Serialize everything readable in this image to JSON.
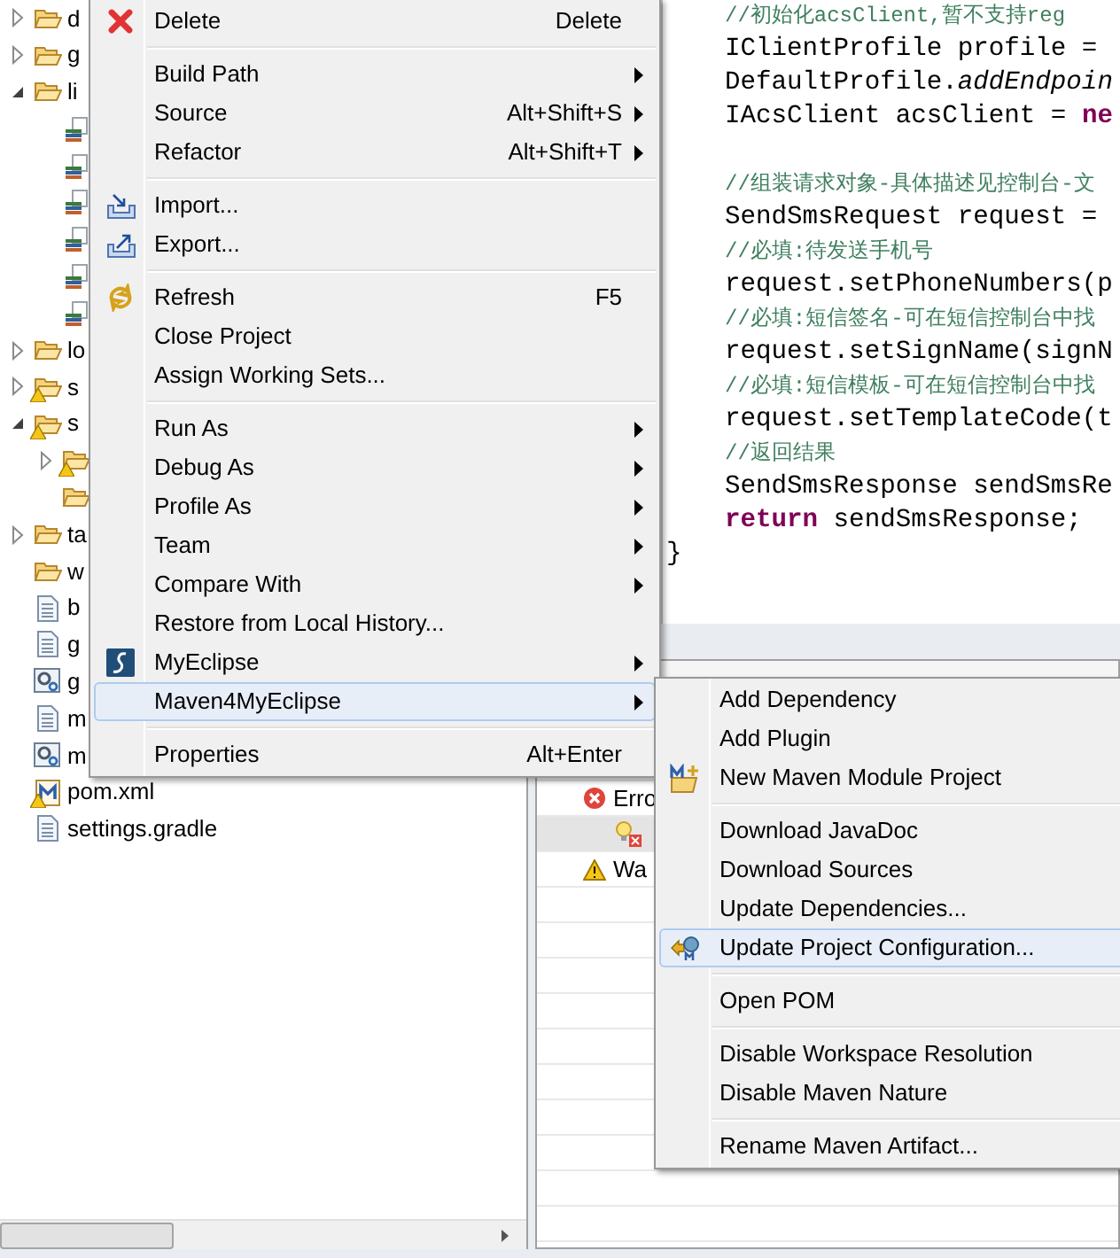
{
  "project_tree": {
    "items": [
      {
        "label": "d",
        "kind": "folder",
        "expanded": false
      },
      {
        "label": "g",
        "kind": "folder",
        "expanded": false
      },
      {
        "label": "li",
        "kind": "folder",
        "expanded": true,
        "children": [
          {
            "kind": "jar"
          },
          {
            "kind": "jar"
          },
          {
            "kind": "jar"
          },
          {
            "kind": "jar"
          },
          {
            "kind": "jar"
          },
          {
            "kind": "jar"
          }
        ]
      },
      {
        "label": "lo",
        "kind": "folder",
        "expanded": false
      },
      {
        "label": "s",
        "kind": "folder",
        "expanded": false,
        "warning": true
      },
      {
        "label": "s",
        "kind": "folder",
        "expanded": true,
        "warning": true,
        "children": [
          {
            "kind": "folder",
            "expanded": false,
            "warning": true
          },
          {
            "kind": "folder"
          }
        ]
      },
      {
        "label": "ta",
        "kind": "folder",
        "expanded": false
      },
      {
        "label": "w",
        "kind": "folder"
      },
      {
        "label": "b",
        "kind": "file"
      },
      {
        "label": "g",
        "kind": "file"
      },
      {
        "label": "g",
        "kind": "config"
      },
      {
        "label": "m",
        "kind": "file"
      },
      {
        "label": "m",
        "kind": "config"
      },
      {
        "label": "pom.xml",
        "kind": "maven",
        "warning": true
      },
      {
        "label": "settings.gradle",
        "kind": "file"
      }
    ]
  },
  "editor": {
    "lines": [
      {
        "kind": "code",
        "indent": true,
        "segments": [
          {
            "text": "//初始化acsClient,暂不支持reg",
            "kind": "comment"
          }
        ]
      },
      {
        "kind": "code",
        "indent": true,
        "segments": [
          {
            "text": "IClientProfile profile = ",
            "kind": "plain"
          }
        ]
      },
      {
        "kind": "code",
        "indent": true,
        "segments": [
          {
            "text": "DefaultProfile.",
            "kind": "plain"
          },
          {
            "text": "addEndpoin",
            "kind": "italic"
          }
        ]
      },
      {
        "kind": "code",
        "indent": true,
        "segments": [
          {
            "text": "IAcsClient acsClient = ",
            "kind": "plain"
          },
          {
            "text": "ne",
            "kind": "keyword"
          }
        ]
      },
      {
        "kind": "blank"
      },
      {
        "kind": "code",
        "indent": true,
        "segments": [
          {
            "text": "//组装请求对象-具体描述见控制台-文",
            "kind": "comment"
          }
        ]
      },
      {
        "kind": "code",
        "indent": true,
        "segments": [
          {
            "text": "SendSmsRequest request = ",
            "kind": "plain"
          }
        ]
      },
      {
        "kind": "code",
        "indent": true,
        "segments": [
          {
            "text": "//必填:待发送手机号",
            "kind": "comment"
          }
        ]
      },
      {
        "kind": "code",
        "indent": true,
        "segments": [
          {
            "text": "request.setPhoneNumbers(p",
            "kind": "plain"
          }
        ]
      },
      {
        "kind": "code",
        "indent": true,
        "segments": [
          {
            "text": "//必填:短信签名-可在短信控制台中找",
            "kind": "comment"
          }
        ]
      },
      {
        "kind": "code",
        "indent": true,
        "segments": [
          {
            "text": "request.setSignName(signN",
            "kind": "plain"
          }
        ]
      },
      {
        "kind": "code",
        "indent": true,
        "segments": [
          {
            "text": "//必填:短信模板-可在短信控制台中找",
            "kind": "comment"
          }
        ]
      },
      {
        "kind": "code",
        "indent": true,
        "segments": [
          {
            "text": "request.setTemplateCode(t",
            "kind": "plain"
          }
        ]
      },
      {
        "kind": "code",
        "indent": true,
        "segments": [
          {
            "text": "//返回结果",
            "kind": "comment"
          }
        ]
      },
      {
        "kind": "code",
        "indent": true,
        "segments": [
          {
            "text": "SendSmsResponse sendSmsRe",
            "kind": "plain"
          }
        ]
      },
      {
        "kind": "code",
        "indent": true,
        "segments": [
          {
            "text": "return",
            "kind": "keyword"
          },
          {
            "text": " sendSmsResponse;",
            "kind": "plain"
          }
        ]
      },
      {
        "kind": "code",
        "indent": false,
        "segments": [
          {
            "text": "}",
            "kind": "plain"
          }
        ]
      }
    ]
  },
  "problems": {
    "rows": [
      {
        "label": "Erro",
        "kind": "error",
        "selected": false
      },
      {
        "kind": "hint",
        "selected": true
      },
      {
        "label": "Wa",
        "kind": "warning",
        "selected": false
      }
    ]
  },
  "context_menu": {
    "items": [
      {
        "kind": "item",
        "label": "Delete",
        "shortcut": "Delete",
        "has_submenu": false,
        "selected": false
      },
      {
        "kind": "separator"
      },
      {
        "kind": "item",
        "label": "Build Path",
        "has_submenu": true,
        "selected": false
      },
      {
        "kind": "item",
        "label": "Source",
        "shortcut": "Alt+Shift+S",
        "has_submenu": true,
        "selected": false
      },
      {
        "kind": "item",
        "label": "Refactor",
        "shortcut": "Alt+Shift+T",
        "has_submenu": true,
        "selected": false
      },
      {
        "kind": "separator"
      },
      {
        "kind": "item",
        "label": "Import...",
        "has_submenu": false,
        "selected": false
      },
      {
        "kind": "item",
        "label": "Export...",
        "has_submenu": false,
        "selected": false
      },
      {
        "kind": "separator"
      },
      {
        "kind": "item",
        "label": "Refresh",
        "shortcut": "F5",
        "has_submenu": false,
        "selected": false
      },
      {
        "kind": "item",
        "label": "Close Project",
        "has_submenu": false,
        "selected": false
      },
      {
        "kind": "item",
        "label": "Assign Working Sets...",
        "has_submenu": false,
        "selected": false
      },
      {
        "kind": "separator"
      },
      {
        "kind": "item",
        "label": "Run As",
        "has_submenu": true,
        "selected": false
      },
      {
        "kind": "item",
        "label": "Debug As",
        "has_submenu": true,
        "selected": false
      },
      {
        "kind": "item",
        "label": "Profile As",
        "has_submenu": true,
        "selected": false
      },
      {
        "kind": "item",
        "label": "Team",
        "has_submenu": true,
        "selected": false
      },
      {
        "kind": "item",
        "label": "Compare With",
        "has_submenu": true,
        "selected": false
      },
      {
        "kind": "item",
        "label": "Restore from Local History...",
        "has_submenu": false,
        "selected": false
      },
      {
        "kind": "item",
        "label": "MyEclipse",
        "has_submenu": true,
        "selected": false
      },
      {
        "kind": "item",
        "label": "Maven4MyEclipse",
        "has_submenu": true,
        "selected": true
      },
      {
        "kind": "separator"
      },
      {
        "kind": "item",
        "label": "Properties",
        "shortcut": "Alt+Enter",
        "has_submenu": false,
        "selected": false
      }
    ]
  },
  "submenu": {
    "items": [
      {
        "kind": "item",
        "label": "Add Dependency",
        "selected": false
      },
      {
        "kind": "item",
        "label": "Add Plugin",
        "selected": false
      },
      {
        "kind": "item",
        "label": "New Maven Module Project",
        "selected": false
      },
      {
        "kind": "separator"
      },
      {
        "kind": "item",
        "label": "Download JavaDoc",
        "selected": false
      },
      {
        "kind": "item",
        "label": "Download Sources",
        "selected": false
      },
      {
        "kind": "item",
        "label": "Update Dependencies...",
        "selected": false
      },
      {
        "kind": "item",
        "label": "Update Project Configuration...",
        "selected": true
      },
      {
        "kind": "separator"
      },
      {
        "kind": "item",
        "label": "Open POM",
        "selected": false
      },
      {
        "kind": "separator"
      },
      {
        "kind": "item",
        "label": "Disable Workspace Resolution",
        "selected": false
      },
      {
        "kind": "item",
        "label": "Disable Maven Nature",
        "selected": false
      },
      {
        "kind": "separator"
      },
      {
        "kind": "item",
        "label": "Rename Maven Artifact...",
        "selected": false
      }
    ]
  }
}
